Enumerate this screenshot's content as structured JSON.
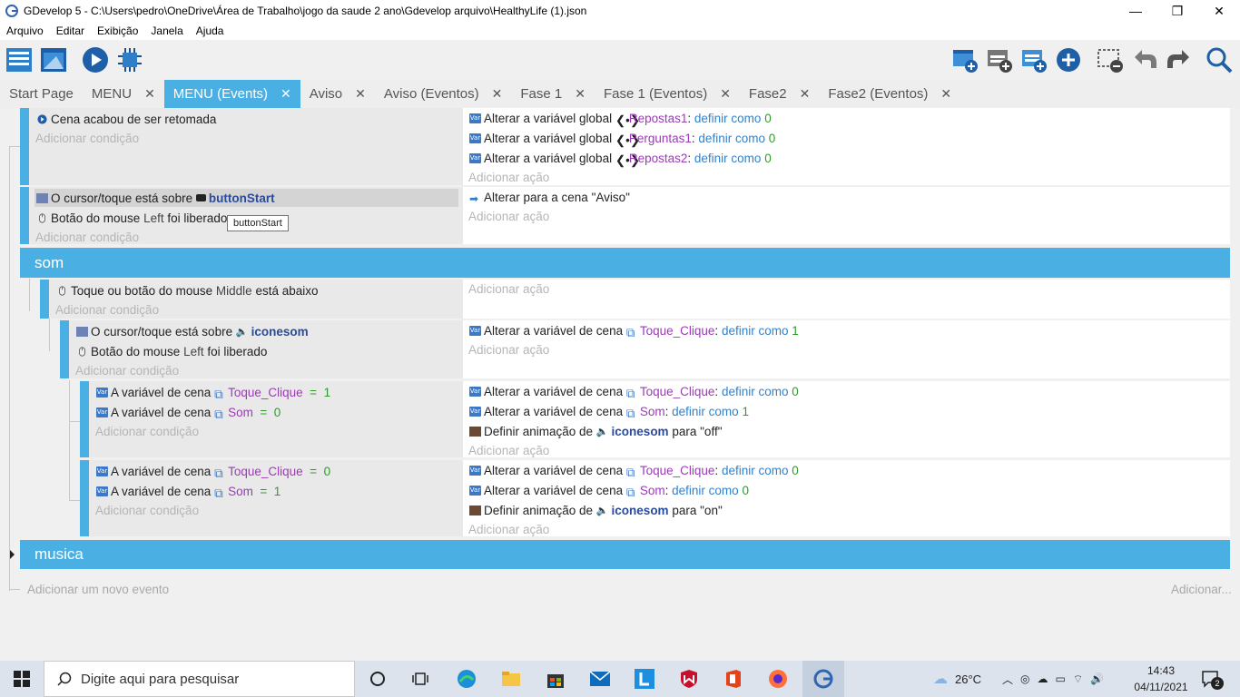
{
  "window": {
    "title": "GDevelop 5 - C:\\Users\\pedro\\OneDrive\\Área de Trabalho\\jogo da saude 2 ano\\Gdevelop arquivo\\HealthyLife (1).json",
    "minimize": "—",
    "maximize": "❐",
    "close": "✕"
  },
  "menu": [
    "Arquivo",
    "Editar",
    "Exibição",
    "Janela",
    "Ajuda"
  ],
  "tabs": [
    {
      "label": "Start Page",
      "closable": false
    },
    {
      "label": "MENU",
      "closable": true
    },
    {
      "label": "MENU (Events)",
      "closable": true,
      "active": true
    },
    {
      "label": "Aviso",
      "closable": true
    },
    {
      "label": "Aviso (Eventos)",
      "closable": true
    },
    {
      "label": "Fase 1",
      "closable": true
    },
    {
      "label": "Fase 1 (Eventos)",
      "closable": true
    },
    {
      "label": "Fase2",
      "closable": true
    },
    {
      "label": "Fase2 (Eventos)",
      "closable": true
    }
  ],
  "tab_close_glyph": "✕",
  "events": {
    "e1": {
      "cond1": "Cena acabou de ser retomada",
      "add_cond": "Adicionar condição",
      "act_prefix": "Alterar a variável global",
      "act1_var": "Repostas1",
      "act2_var": "Perguntas1",
      "act3_var": "Repostas2",
      "set_as": "definir como",
      "value0": "0",
      "add_act": "Adicionar ação"
    },
    "e2": {
      "cond1_text": "O cursor/toque está sobre",
      "cond1_obj": "buttonStart",
      "cond2_text": "Botão do mouse",
      "cond2_btn": "Left",
      "cond2_suffix": "foi liberado",
      "tooltip": "buttonStart",
      "act1_text": "Alterar para a cena",
      "act1_scene": "\"Aviso\""
    },
    "group_som": "som",
    "e3": {
      "cond1_text": "Toque ou botão do mouse",
      "cond1_btn": "Middle",
      "cond1_suffix": "está abaixo"
    },
    "e4": {
      "cond1_text": "O cursor/toque está sobre",
      "cond1_obj": "iconesom",
      "cond2_text": "Botão do mouse",
      "cond2_btn": "Left",
      "cond2_suffix": "foi liberado",
      "act_prefix": "Alterar a variável de cena",
      "act1_var": "Toque_Clique",
      "value1": "1"
    },
    "e5": {
      "cond_prefix": "A variável de cena",
      "c1_var": "Toque_Clique",
      "c1_op": "=",
      "c1_val": "1",
      "c2_var": "Som",
      "c2_op": "=",
      "c2_val": "0",
      "a1_var": "Toque_Clique",
      "a1_val": "0",
      "a2_var": "Som",
      "a2_val": "1",
      "anim_prefix": "Definir animação de",
      "anim_obj": "iconesom",
      "anim_para": "para",
      "anim_val": "\"off\""
    },
    "e6": {
      "c1_var": "Toque_Clique",
      "c1_op": "=",
      "c1_val": "0",
      "c2_var": "Som",
      "c2_op": "=",
      "c2_val": "1",
      "a1_var": "Toque_Clique",
      "a1_val": "0",
      "a2_var": "Som",
      "a2_val": "0",
      "anim_val": "\"on\""
    },
    "group_musica": "musica",
    "add_event": "Adicionar um novo evento",
    "add_more": "Adicionar..."
  },
  "taskbar": {
    "search_placeholder": "Digite aqui para pesquisar",
    "temperature": "26°C",
    "time": "14:43",
    "date": "04/11/2021",
    "notifications": "2"
  }
}
